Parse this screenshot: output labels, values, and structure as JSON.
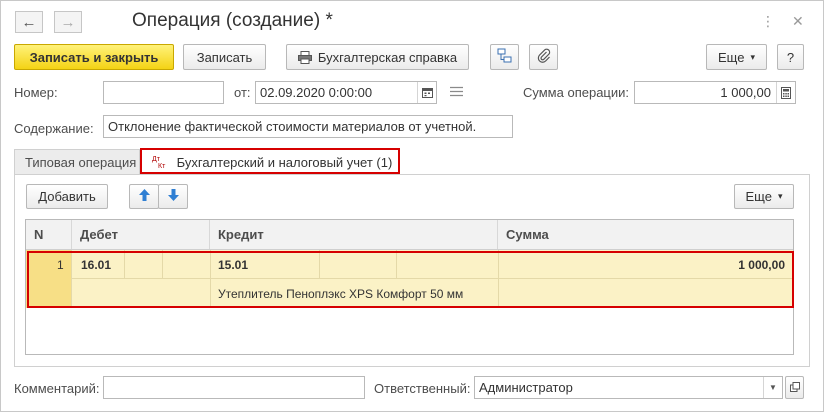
{
  "window": {
    "title": "Операция (создание) *",
    "nav": [
      {
        "icon": "back-arrow-icon",
        "glyph": "←"
      },
      {
        "icon": "forward-arrow-icon",
        "glyph": "→"
      }
    ],
    "controls": {
      "menu_glyph": "⋮",
      "close_glyph": "✕"
    }
  },
  "toolbar": {
    "save_close": "Записать и закрыть",
    "save": "Записать",
    "report": "Бухгалтерская справка",
    "more": "Еще",
    "more_caret": "▾",
    "help": "?"
  },
  "form": {
    "number_label": "Номер:",
    "number_value": "",
    "date_label": "от:",
    "date_value": "02.09.2020  0:00:00",
    "sum_label": "Сумма операции:",
    "sum_value": "1 000,00",
    "content_label": "Содержание:",
    "content_value": "Отклонение фактической стоимости материалов от учетной."
  },
  "tabs": [
    {
      "label": "Типовая операция"
    },
    {
      "label": "Бухгалтерский и налоговый учет (1)",
      "icon_text": "Дт\nКт"
    }
  ],
  "table_toolbar": {
    "add": "Добавить",
    "more": "Еще",
    "more_caret": "▾"
  },
  "table": {
    "columns": [
      "N",
      "Дебет",
      "Кредит",
      "Сумма"
    ],
    "rows": [
      {
        "n": "1",
        "debit": "16.01",
        "credit": "15.01",
        "amount": "1 000,00",
        "credit_subconto": "Утеплитель Пеноплэкс XPS Комфорт 50 мм"
      }
    ]
  },
  "footer": {
    "comment_label": "Комментарий:",
    "comment_value": "",
    "responsible_label": "Ответственный:",
    "responsible_value": "Администратор"
  },
  "colors": {
    "primary_button": "#f4d315",
    "highlight_frame": "#d60000",
    "selected_row": "#fbf2c6"
  }
}
